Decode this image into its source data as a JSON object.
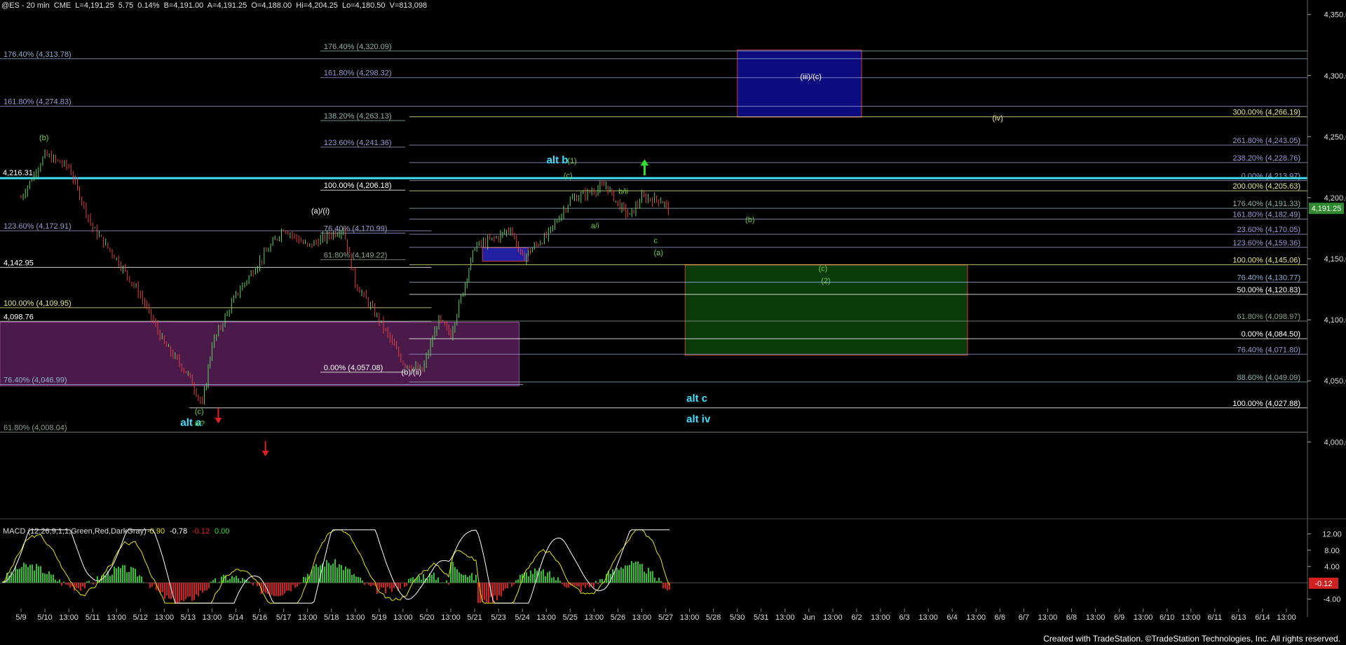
{
  "header": {
    "symbol": "@ES - 20 min  CME  L=4,191.25  5.75  0.14%  B=4,191.00  A=4,191.25  O=4,188.00  Hi=4,204.25  Lo=4,180.50  V=813,098"
  },
  "footer": {
    "credit": "Created with TradeStation. ©TradeStation Technologies, Inc. All rights reserved."
  },
  "chart_data": {
    "type": "candlestick",
    "price_axis": {
      "ylim": [
        3960,
        4355
      ],
      "ticks": [
        "4,350.00",
        "4,300.00",
        "4,250.00",
        "4,200.00",
        "4,150.00",
        "4,100.00",
        "4,050.00",
        "4,000.00"
      ],
      "tick_values": [
        4350,
        4300,
        4250,
        4200,
        4150,
        4100,
        4050,
        4000
      ]
    },
    "last_price": {
      "label": "4,191.25",
      "value": 4191.25,
      "color": "#2e8b2e"
    },
    "x_labels": [
      "5/9",
      "5/10",
      "13:00",
      "5/11",
      "13:00",
      "5/12",
      "13:00",
      "5/13",
      "13:00",
      "5/14",
      "5/16",
      "5/17",
      "13:00",
      "5/18",
      "13:00",
      "5/19",
      "13:00",
      "5/20",
      "13:00",
      "5/21",
      "5/23",
      "5/24",
      "13:00",
      "5/25",
      "13:00",
      "5/26",
      "13:00",
      "5/27",
      "13:00",
      "5/28",
      "5/30",
      "5/31",
      "13:00",
      "Jun",
      "13:00",
      "6/2",
      "13:00",
      "6/3",
      "13:00",
      "6/4",
      "13:00",
      "6/6",
      "6/7",
      "13:00",
      "6/8",
      "13:00",
      "6/9",
      "13:00",
      "6/10",
      "13:00",
      "6/11",
      "6/13",
      "6/14",
      "13:00"
    ],
    "x_label_slots": [
      0,
      1,
      2,
      3,
      4,
      5,
      6,
      7,
      8,
      9,
      10,
      11,
      12,
      13,
      14,
      15,
      16,
      17,
      18,
      19,
      20,
      21,
      22,
      23,
      24,
      25,
      26,
      27,
      28,
      29,
      30,
      31,
      32,
      33,
      34,
      35,
      36,
      37,
      38,
      39,
      40,
      41,
      42,
      43,
      44,
      45,
      46,
      47,
      48,
      49,
      50,
      51,
      52,
      53
    ],
    "price_path": [
      [
        0,
        4200
      ],
      [
        1,
        4235
      ],
      [
        2,
        4225
      ],
      [
        3,
        4175
      ],
      [
        4,
        4150
      ],
      [
        5,
        4120
      ],
      [
        6,
        4080
      ],
      [
        7,
        4055
      ],
      [
        7.6,
        4030
      ],
      [
        8,
        4080
      ],
      [
        9,
        4120
      ],
      [
        10,
        4148
      ],
      [
        11,
        4175
      ],
      [
        12,
        4160
      ],
      [
        13,
        4170
      ],
      [
        13.5,
        4174
      ],
      [
        14,
        4130
      ],
      [
        15,
        4100
      ],
      [
        16,
        4065
      ],
      [
        16.8,
        4058
      ],
      [
        17.5,
        4100
      ],
      [
        18,
        4088
      ],
      [
        18.6,
        4130
      ],
      [
        19,
        4160
      ],
      [
        20,
        4168
      ],
      [
        20.5,
        4175
      ],
      [
        21,
        4150
      ],
      [
        21.5,
        4160
      ],
      [
        22,
        4168
      ],
      [
        23,
        4198
      ],
      [
        24,
        4206
      ],
      [
        24.5,
        4210
      ],
      [
        25,
        4195
      ],
      [
        25.5,
        4185
      ],
      [
        26,
        4200
      ],
      [
        26.8,
        4198
      ],
      [
        27.2,
        4190
      ]
    ],
    "fib_lines": [
      {
        "label": "176.40% (4,313.78)",
        "value": 4313.78,
        "x0": 0,
        "x1": 1,
        "color": "#8fa8c8",
        "side": "left"
      },
      {
        "label": "161.80% (4,274.83)",
        "value": 4274.83,
        "x0": 0,
        "x1": 1,
        "color": "#9a9ad0",
        "side": "left"
      },
      {
        "label": "123.60% (4,172.91)",
        "value": 4172.91,
        "x0": 0,
        "x1": 0.33,
        "color": "#9a9ad0",
        "side": "left"
      },
      {
        "label": "4,142.95",
        "value": 4142.95,
        "x0": 0,
        "x1": 0.33,
        "color": "#ffffff",
        "side": "left"
      },
      {
        "label": "100.00% (4,109.95)",
        "value": 4109.95,
        "x0": 0,
        "x1": 0.33,
        "color": "#e6e68a",
        "side": "left"
      },
      {
        "label": "4,098.76",
        "value": 4098.76,
        "x0": 0,
        "x1": 0.33,
        "color": "#ffffff",
        "side": "left"
      },
      {
        "label": "76.40% (4,046.99)",
        "value": 4046.99,
        "x0": 0,
        "x1": 0.4,
        "color": "#8fb0d0",
        "side": "left"
      },
      {
        "label": "61.80% (4,008.04)",
        "value": 4008.04,
        "x0": 0,
        "x1": 1,
        "color": "#8aa08a",
        "side": "left"
      },
      {
        "label": "176.40% (4,320.09)",
        "value": 4320.09,
        "x0": 0.245,
        "x1": 1,
        "color": "#8fb0b0",
        "side": "left"
      },
      {
        "label": "161.80% (4,298.32)",
        "value": 4298.32,
        "x0": 0.245,
        "x1": 1,
        "color": "#9a9ad0",
        "side": "left"
      },
      {
        "label": "138.20% (4,263.13)",
        "value": 4263.13,
        "x0": 0.245,
        "x1": 0.31,
        "color": "#8fb0b0",
        "side": "left"
      },
      {
        "label": "123.60% (4,241.36)",
        "value": 4241.36,
        "x0": 0.245,
        "x1": 0.31,
        "color": "#9a9ad0",
        "side": "left"
      },
      {
        "label": "100.00% (4,206.18)",
        "value": 4206.18,
        "x0": 0.245,
        "x1": 0.31,
        "color": "#ffffff",
        "side": "left"
      },
      {
        "label": "76.40% (4,170.99)",
        "value": 4170.99,
        "x0": 0.245,
        "x1": 0.31,
        "color": "#9a9ad0",
        "side": "left"
      },
      {
        "label": "61.80% (4,149.22)",
        "value": 4149.22,
        "x0": 0.245,
        "x1": 0.31,
        "color": "#8aa08a",
        "side": "left"
      },
      {
        "label": "0.00% (4,057.08)",
        "value": 4057.08,
        "x0": 0.245,
        "x1": 0.31,
        "color": "#ffffff",
        "side": "left"
      },
      {
        "label": "300.00% (4,266.19)",
        "value": 4266.19,
        "x0": 0.313,
        "x1": 1,
        "color": "#e6e68a",
        "side": "right"
      },
      {
        "label": "261.80% (4,243.05)",
        "value": 4243.05,
        "x0": 0.313,
        "x1": 1,
        "color": "#9a9ad0",
        "side": "right"
      },
      {
        "label": "238.20% (4,228.76)",
        "value": 4228.76,
        "x0": 0.313,
        "x1": 1,
        "color": "#9a9ad0",
        "side": "right"
      },
      {
        "label": "0.00% (4,213.97)",
        "value": 4213.97,
        "x0": 0.313,
        "x1": 1,
        "color": "#9a9ad0",
        "side": "right"
      },
      {
        "label": "200.00% (4,205.63)",
        "value": 4205.63,
        "x0": 0.313,
        "x1": 1,
        "color": "#e6e68a",
        "side": "right"
      },
      {
        "label": "176.40% (4,191.33)",
        "value": 4191.33,
        "x0": 0.313,
        "x1": 1,
        "color": "#8fb0b0",
        "side": "right"
      },
      {
        "label": "161.80% (4,182.49)",
        "value": 4182.49,
        "x0": 0.313,
        "x1": 1,
        "color": "#9a9ad0",
        "side": "right"
      },
      {
        "label": "23.60% (4,170.05)",
        "value": 4170.05,
        "x0": 0.313,
        "x1": 1,
        "color": "#9a9ad0",
        "side": "right"
      },
      {
        "label": "123.60% (4,159.36)",
        "value": 4159.36,
        "x0": 0.313,
        "x1": 1,
        "color": "#9a9ad0",
        "side": "right"
      },
      {
        "label": "100.00% (4,145.06)",
        "value": 4145.06,
        "x0": 0.313,
        "x1": 1,
        "color": "#e6e68a",
        "side": "right"
      },
      {
        "label": "76.40% (4,130.77)",
        "value": 4130.77,
        "x0": 0.313,
        "x1": 1,
        "color": "#8fb0d0",
        "side": "right"
      },
      {
        "label": "50.00% (4,120.83)",
        "value": 4120.83,
        "x0": 0.313,
        "x1": 1,
        "color": "#ffffff",
        "side": "right"
      },
      {
        "label": "61.80% (4,098.97)",
        "value": 4098.97,
        "x0": 0.313,
        "x1": 1,
        "color": "#8aa08a",
        "side": "right"
      },
      {
        "label": "0.00% (4,084.50)",
        "value": 4084.5,
        "x0": 0.313,
        "x1": 1,
        "color": "#ffffff",
        "side": "right"
      },
      {
        "label": "76.40% (4,071.80)",
        "value": 4071.8,
        "x0": 0.313,
        "x1": 1,
        "color": "#9a9ad0",
        "side": "right"
      },
      {
        "label": "88.60% (4,049.09)",
        "value": 4049.09,
        "x0": 0.313,
        "x1": 1,
        "color": "#8fb0b0",
        "side": "right"
      },
      {
        "label": "100.00% (4,027.88)",
        "value": 4027.88,
        "x0": 0.145,
        "x1": 1,
        "color": "#ffffff",
        "side": "right"
      }
    ],
    "cyan_line": {
      "value": 4216,
      "label": "4,216.31",
      "color": "#40e0ff"
    },
    "zones": [
      {
        "name": "purple-support-zone",
        "x0": 0,
        "x1": 0.397,
        "y0": 4098,
        "y1": 4046,
        "fill": "#4a1a4a",
        "stroke": "#a04aa0"
      },
      {
        "name": "blue-target-box",
        "x0": 0.564,
        "x1": 0.659,
        "y0": 4321,
        "y1": 4266,
        "fill": "#0c0c80",
        "stroke": "#c04040"
      },
      {
        "name": "green-support-box",
        "x0": 0.524,
        "x1": 0.74,
        "y0": 4145,
        "y1": 4071,
        "fill": "#0b3a0b",
        "stroke": "#c04040"
      },
      {
        "name": "small-blue-box",
        "x0": 0.369,
        "x1": 0.404,
        "y0": 4159,
        "y1": 4148,
        "fill": "#2020a0",
        "stroke": "#c04040"
      }
    ],
    "wave_labels": [
      {
        "text": "(b)",
        "x": 0.03,
        "y": 4247,
        "color": "#6dcc3a",
        "size": 11
      },
      {
        "text": "(a)/(i)",
        "x": 0.238,
        "y": 4187,
        "color": "#ffffff",
        "size": 11
      },
      {
        "text": "(b)/(ii)",
        "x": 0.307,
        "y": 4055,
        "color": "#ffffff",
        "size": 11
      },
      {
        "text": "(c)",
        "x": 0.149,
        "y": 4023,
        "color": "#6dcc3a",
        "size": 11
      },
      {
        "text": "alt a",
        "x": 0.138,
        "y": 4013,
        "color": "#40e0ff",
        "size": 15
      },
      {
        "text": "iv?",
        "x": 0.149,
        "y": 4013,
        "color": "#6dcc3a",
        "size": 11
      },
      {
        "text": "(iii)/(c)",
        "x": 0.612,
        "y": 4297,
        "color": "#ffffff",
        "size": 11
      },
      {
        "text": "(iv)",
        "x": 0.759,
        "y": 4263,
        "color": "#e6e68a",
        "size": 11
      },
      {
        "text": "alt b",
        "x": 0.418,
        "y": 4228,
        "color": "#40e0ff",
        "size": 15
      },
      {
        "text": "(1)",
        "x": 0.434,
        "y": 4228,
        "color": "#6dcc3a",
        "size": 11
      },
      {
        "text": "(c)",
        "x": 0.431,
        "y": 4216,
        "color": "#6dcc3a",
        "size": 11
      },
      {
        "text": "b/ii",
        "x": 0.473,
        "y": 4203,
        "color": "#6dcc3a",
        "size": 11
      },
      {
        "text": "a/i",
        "x": 0.452,
        "y": 4175,
        "color": "#6dcc3a",
        "size": 11
      },
      {
        "text": "c",
        "x": 0.5,
        "y": 4163,
        "color": "#6dcc3a",
        "size": 11
      },
      {
        "text": "(a)",
        "x": 0.5,
        "y": 4153,
        "color": "#6dcc3a",
        "size": 11
      },
      {
        "text": "(b)",
        "x": 0.57,
        "y": 4180,
        "color": "#6dcc3a",
        "size": 11
      },
      {
        "text": "(c)",
        "x": 0.626,
        "y": 4140,
        "color": "#6dcc3a",
        "size": 11
      },
      {
        "text": "(2)",
        "x": 0.628,
        "y": 4130,
        "color": "#6dcc3a",
        "size": 11
      },
      {
        "text": "alt c",
        "x": 0.525,
        "y": 4033,
        "color": "#40e0ff",
        "size": 15
      },
      {
        "text": "alt iv",
        "x": 0.525,
        "y": 4016,
        "color": "#40e0ff",
        "size": 15
      }
    ],
    "arrows": [
      {
        "x": 0.167,
        "y": 4022,
        "dir": "down",
        "color": "#e02020"
      },
      {
        "x": 0.203,
        "y": 3995,
        "dir": "down",
        "color": "#e02020"
      },
      {
        "x": 0.493,
        "y": 4224,
        "dir": "up",
        "color": "#30e030"
      }
    ],
    "macd": {
      "label": "MACD (12,26,9,1,1,Green,Red,DarkGray)",
      "vals": [
        {
          "text": "-0.90",
          "color": "#e6e600"
        },
        {
          "text": "-0.78",
          "color": "#ffffff"
        },
        {
          "text": "-0.12",
          "color": "#e02020"
        },
        {
          "text": "0.00",
          "color": "#30e030"
        }
      ],
      "ylim": [
        -6,
        14
      ],
      "ticks": [
        "12.00",
        "8.00",
        "4.00",
        "-4.00"
      ],
      "tick_values": [
        12,
        8,
        4,
        -4
      ],
      "last_label": "-0.12",
      "last_value": -0.12
    }
  }
}
